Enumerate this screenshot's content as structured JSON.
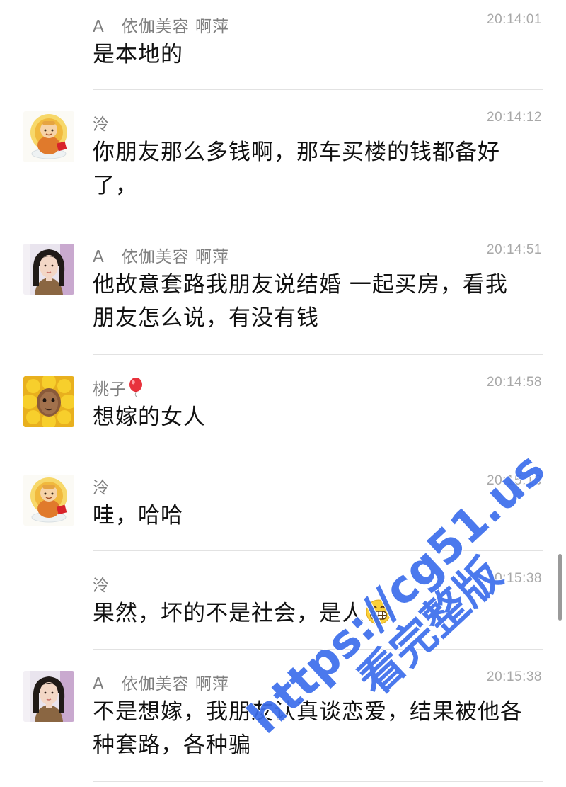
{
  "messages": [
    {
      "sender": "A　依伽美容 啊萍",
      "time": "20:14:01",
      "text": "是本地的",
      "avatar": "woman-photo-avatar",
      "show_avatar": false
    },
    {
      "sender": "泠",
      "time": "20:14:12",
      "text": "你朋友那么多钱啊，那车买楼的钱都备好了，",
      "avatar": "buddha-cartoon-avatar",
      "show_avatar": true
    },
    {
      "sender": "A　依伽美容 啊萍",
      "time": "20:14:51",
      "text": "他故意套路我朋友说结婚 一起买房，看我朋友怎么说，有没有钱",
      "avatar": "woman-photo-avatar",
      "show_avatar": true
    },
    {
      "sender": "桃子",
      "time": "20:14:58",
      "text": "想嫁的女人",
      "avatar": "sunflower-face-avatar",
      "show_avatar": true
    },
    {
      "sender": "泠",
      "time": "20:15:13",
      "text": "哇，哈哈",
      "avatar": "buddha-cartoon-avatar",
      "show_avatar": true
    },
    {
      "sender": "泠",
      "time": "20:15:38",
      "text": "果然，坏的不是社会，是人",
      "avatar": "buddha-cartoon-avatar",
      "show_avatar": false
    },
    {
      "sender": "A　依伽美容 啊萍",
      "time": "20:15:38",
      "text": "不是想嫁，我朋友认真谈恋爱，结果被他各种套路，各种骗",
      "avatar": "woman-photo-avatar",
      "show_avatar": true
    }
  ],
  "icons": {
    "balloon": "red-balloon-icon",
    "grin": "grinning-face-emoji"
  },
  "watermark": {
    "url": "https://cg51.us",
    "subtitle": "看完整版"
  },
  "colors": {
    "sender": "#7f7f7f",
    "time": "#a8a8a8",
    "text": "#111111",
    "divider": "#e2e2e2",
    "watermark": "#3c6eeb"
  }
}
